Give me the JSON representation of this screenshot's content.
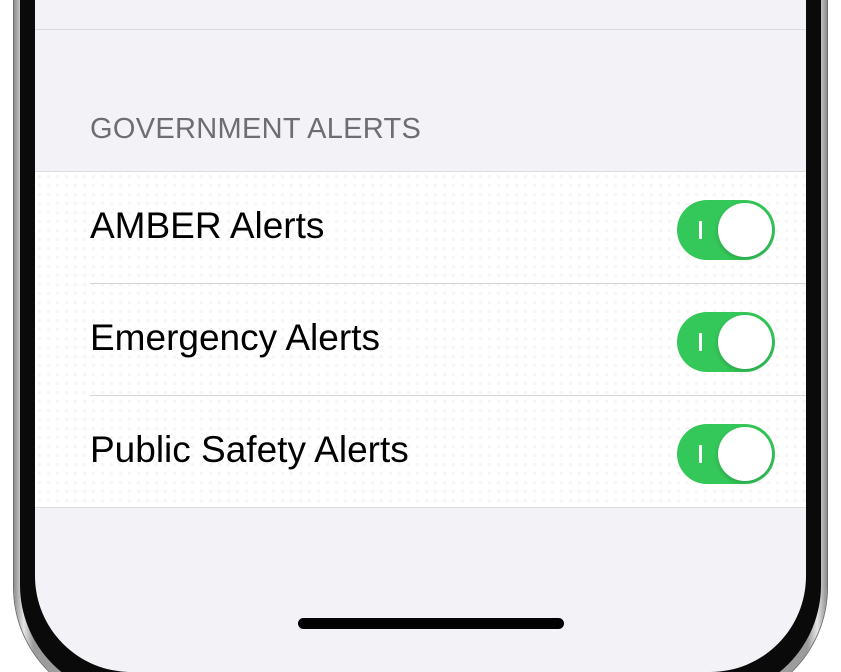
{
  "section": {
    "header": "GOVERNMENT ALERTS"
  },
  "alerts": [
    {
      "label": "AMBER Alerts",
      "enabled": true
    },
    {
      "label": "Emergency Alerts",
      "enabled": true
    },
    {
      "label": "Public Safety Alerts",
      "enabled": true
    }
  ],
  "colors": {
    "toggle_on": "#34c759",
    "background": "#f2f2f7",
    "header_text": "#6d6d72"
  },
  "icons": {
    "toggle_on_mark": "toggle-on-indicator-icon"
  }
}
